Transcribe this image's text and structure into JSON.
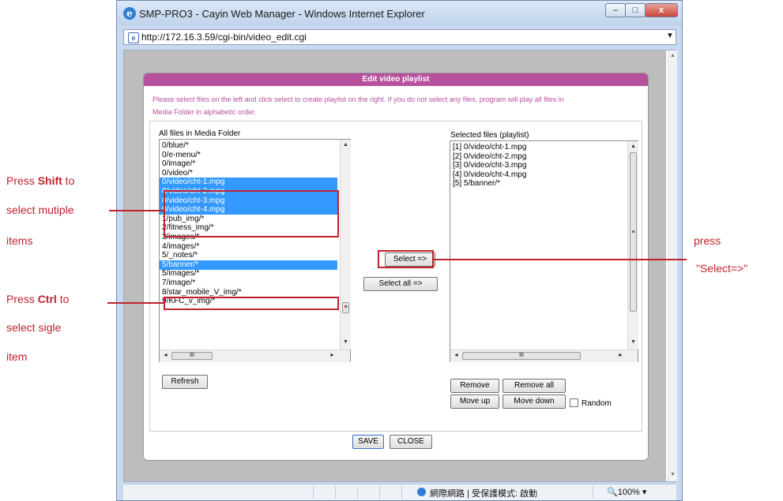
{
  "window": {
    "title": "SMP-PRO3 - Cayin Web Manager - Windows Internet Explorer",
    "url": "http://172.16.3.59/cgi-bin/video_edit.cgi",
    "buttons": {
      "minimize": "–",
      "maximize": "□",
      "close": "x"
    }
  },
  "dialog": {
    "title": "Edit video playlist",
    "instruction_line1": "Please select files on the left and click select to create playlist on the right. If you do not select any files, program will play all files in",
    "instruction_line2": "Media Folder in alphabetic order.",
    "left_label": "All files in Media Folder",
    "right_label": "Selected files (playlist)",
    "left_items": [
      {
        "text": "0/blue/*",
        "selected": false
      },
      {
        "text": "0/e-menu/*",
        "selected": false
      },
      {
        "text": "0/image/*",
        "selected": false
      },
      {
        "text": "0/video/*",
        "selected": false
      },
      {
        "text": "0/video/cht-1.mpg",
        "selected": true
      },
      {
        "text": "0/video/cht-2.mpg",
        "selected": true
      },
      {
        "text": "0/video/cht-3.mpg",
        "selected": true
      },
      {
        "text": "0/video/cht-4.mpg",
        "selected": true
      },
      {
        "text": "1/pub_img/*",
        "selected": false
      },
      {
        "text": "2/fitness_img/*",
        "selected": false
      },
      {
        "text": "3/images/*",
        "selected": false
      },
      {
        "text": "4/images/*",
        "selected": false
      },
      {
        "text": "5/_notes/*",
        "selected": false
      },
      {
        "text": "5/banner/*",
        "selected": true
      },
      {
        "text": "5/images/*",
        "selected": false
      },
      {
        "text": "7/image/*",
        "selected": false
      },
      {
        "text": "8/star_mobile_V_img/*",
        "selected": false
      },
      {
        "text": "9/KFC_v_img/*",
        "selected": false
      }
    ],
    "right_items": [
      "[1] 0/video/cht-1.mpg",
      "[2] 0/video/cht-2.mpg",
      "[3] 0/video/cht-3.mpg",
      "[4] 0/video/cht-4.mpg",
      "[5] 5/banner/*"
    ],
    "buttons": {
      "select": "Select =>",
      "select_all": "Select all =>",
      "refresh": "Refresh",
      "remove": "Remove",
      "remove_all": "Remove all",
      "move_up": "Move up",
      "move_down": "Move down",
      "random": "Random",
      "save": "SAVE",
      "close": "CLOSE"
    },
    "hscroll_grip": "III",
    "vscroll_grip": "≡"
  },
  "statusbar": {
    "zone_text": "網際網路 | 受保護模式: 啟動",
    "zoom": "100%"
  },
  "annotations": {
    "shift_line1_pre": "Press ",
    "shift_key": "Shift",
    "shift_line1_post": " to",
    "shift_line2": "select mutiple",
    "shift_line3": "items",
    "ctrl_line1_pre": "Press ",
    "ctrl_key": "Ctrl",
    "ctrl_line1_post": " to",
    "ctrl_line2": "select sigle",
    "ctrl_line3": "item",
    "press_line1": "press",
    "press_line2": "\"Select=>\""
  },
  "colors": {
    "accent": "#b7509d",
    "selection": "#3399ff",
    "annotation": "#c0222c"
  }
}
